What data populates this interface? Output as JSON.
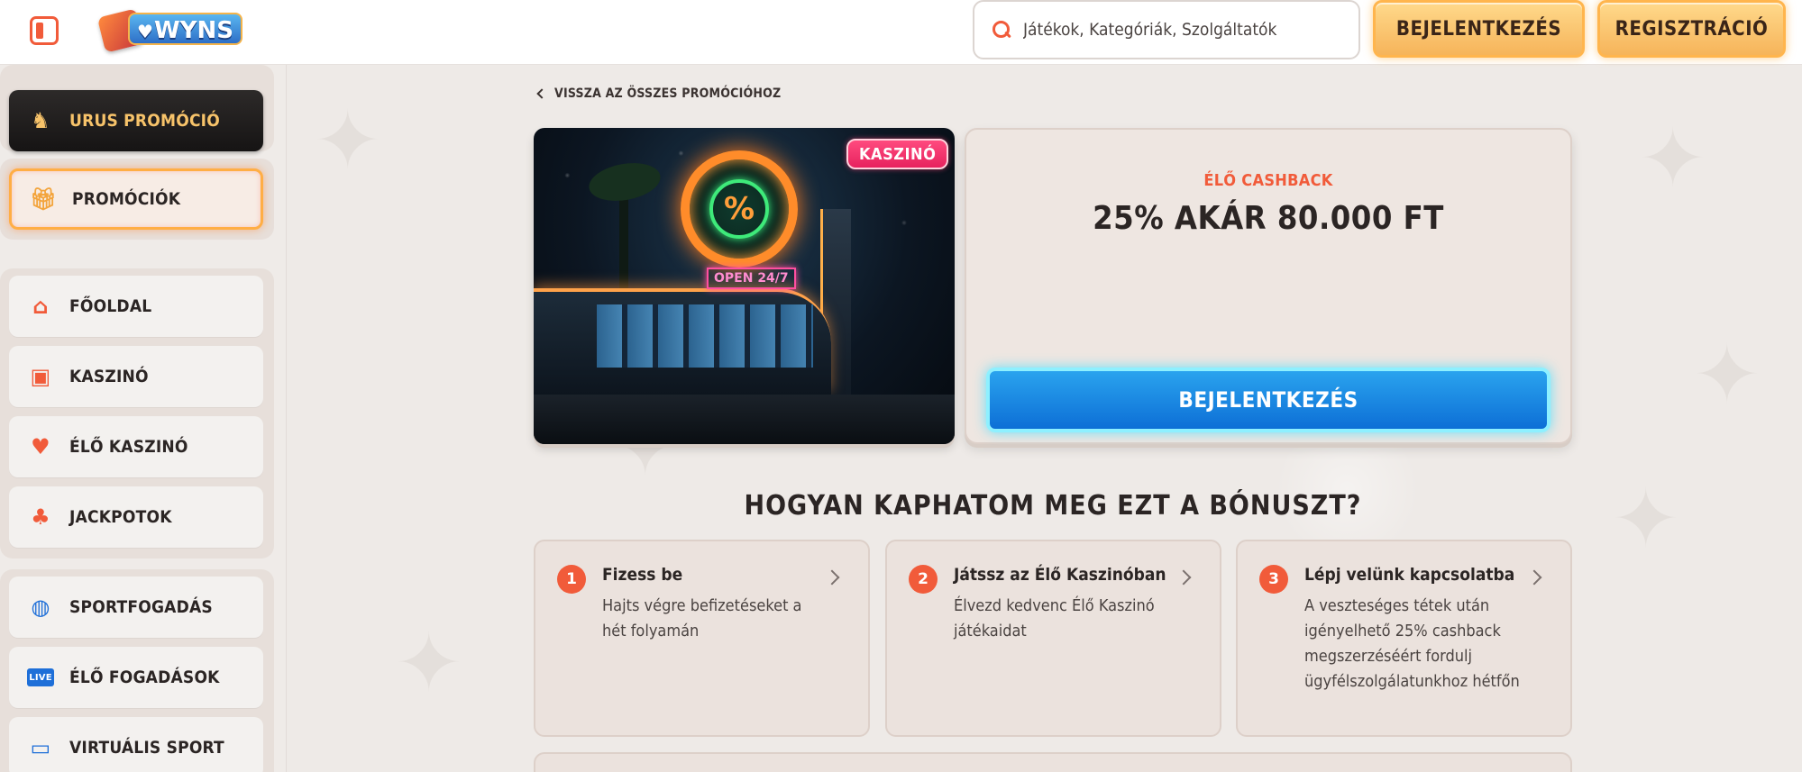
{
  "header": {
    "search_placeholder": "Játékok, Kategóriák, Szolgáltatók",
    "login_label": "BEJELENTKEZÉS",
    "register_label": "REGISZTRÁCIÓ",
    "logo_text": "WYNS"
  },
  "sidebar": {
    "urus": {
      "label": "URUS PROMÓCIÓ",
      "icon": "bull-icon"
    },
    "promo": {
      "label": "PROMÓCIÓK",
      "icon": "gift-icon"
    },
    "main_items": [
      {
        "label": "FŐOLDAL",
        "icon": "home-icon"
      },
      {
        "label": "KASZINÓ",
        "icon": "slot-machine-icon"
      },
      {
        "label": "ÉLŐ KASZINÓ",
        "icon": "card-icon"
      },
      {
        "label": "JACKPOTOK",
        "icon": "clover-icon"
      }
    ],
    "sport_items": [
      {
        "label": "SPORTFOGADÁS",
        "icon": "basketball-icon"
      },
      {
        "label": "ÉLŐ FOGADÁSOK",
        "icon": "live-icon",
        "badge": "LIVE"
      },
      {
        "label": "VIRTUÁLIS SPORT",
        "icon": "monitor-icon"
      }
    ]
  },
  "main": {
    "back_link": "VISSZA AZ ÖSSZES PROMÓCIÓHOZ",
    "image_badge": "KASZINÓ",
    "image_sign": "OPEN 24/7",
    "promo_kicker": "ÉLŐ CASHBACK",
    "promo_title": "25% AKÁR 80.000 FT",
    "promo_button": "BEJELENTKEZÉS",
    "how_title": "HOGYAN KAPHATOM MEG EZT A BÓNUSZT?",
    "steps": [
      {
        "num": "1",
        "title": "Fizess be",
        "text": "Hajts végre befizetéseket a hét folyamán"
      },
      {
        "num": "2",
        "title": "Játssz az Élő Kaszinóban",
        "text": "Élvezd kedvenc Élő Kaszinó játékaidat"
      },
      {
        "num": "3",
        "title": "Lépj velünk kapcsolatba",
        "text": "A veszteséges tétek után igényelhető 25% cashback megszerzéséért fordulj ügyfélszolgálatunkhoz hétfőn"
      }
    ]
  },
  "colors": {
    "accent": "#f15b3a",
    "gold": "#f6b45a",
    "blue": "#1a8be6",
    "badge_pink": "#ee2f68"
  }
}
